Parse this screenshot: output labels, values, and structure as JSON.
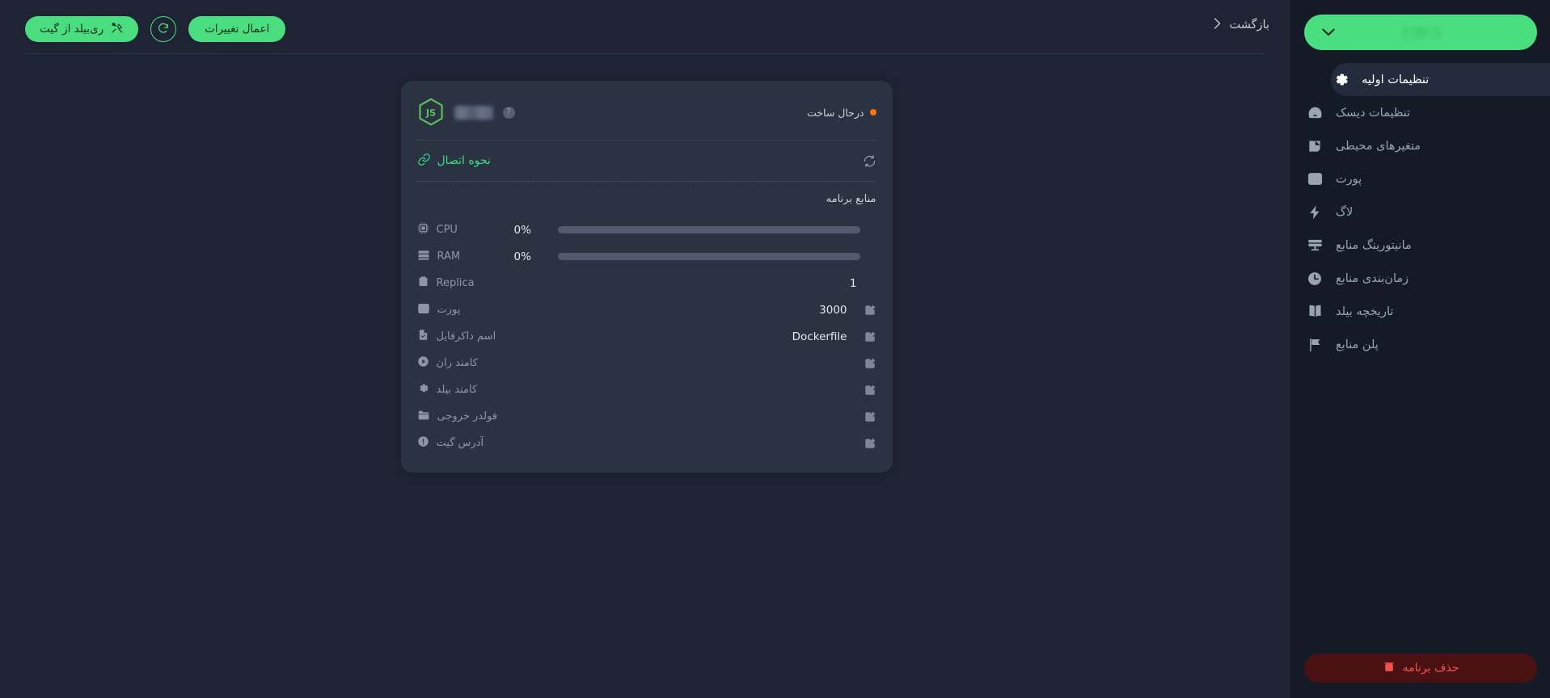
{
  "app": {
    "platform_icon": "nodejs-logo",
    "name_redacted": true,
    "status_label": "درحال ساخت",
    "status_color": "#f97316",
    "help_icon": "?"
  },
  "topbar": {
    "back_label": "بازگشت",
    "back_icon": "chevron-left-icon",
    "apply_changes_label": "اعمال تغییرات",
    "refresh_icon": "refresh-icon",
    "rebuild_from_git_label": "ری‌بیلد از گیت",
    "rebuild_icon": "tools-icon"
  },
  "sidebar": {
    "selector": {
      "icon": "chevron-down-icon",
      "value_redacted": ""
    },
    "items": [
      {
        "label": "تنظیمات اولیه",
        "icon": "gear-icon",
        "active": true
      },
      {
        "label": "تنظیمات دیسک",
        "icon": "hard-drive-icon",
        "active": false
      },
      {
        "label": "متغیرهای محیطی",
        "icon": "memory-chip-icon",
        "active": false
      },
      {
        "label": "پورت",
        "icon": "browser-window-icon",
        "active": false
      },
      {
        "label": "لاگ",
        "icon": "lightning-bolt-icon",
        "active": false
      },
      {
        "label": "مانیتورینگ منابع",
        "icon": "monitor-icon",
        "active": false
      },
      {
        "label": "زمان‌بندی منابع",
        "icon": "clock-icon",
        "active": false
      },
      {
        "label": "تاریخچه بیلد",
        "icon": "book-icon",
        "active": false
      },
      {
        "label": "پلن منابع",
        "icon": "flag-icon",
        "active": false
      }
    ],
    "delete_app": {
      "label": "حذف برنامه",
      "icon": "trash-icon",
      "color": "#ef5350",
      "background": "#4a1113"
    }
  },
  "card": {
    "connection": {
      "label": "نحوه اتصال",
      "icon": "link-icon",
      "color": "#3ddc84",
      "refresh_icon": "refresh-icon"
    },
    "resources_title": "منابع برنامه",
    "meters": [
      {
        "label": "CPU",
        "icon": "cpu-icon",
        "value": "0%",
        "percent": 0
      },
      {
        "label": "RAM",
        "icon": "ram-icon",
        "value": "0%",
        "percent": 0
      }
    ],
    "properties": [
      {
        "label": "Replica",
        "icon": "clipboard-icon",
        "value": "1",
        "editable": false
      },
      {
        "label": "پورت",
        "icon": "browser-window-icon",
        "value": "3000",
        "editable": true
      },
      {
        "label": "اسم داکرفایل",
        "icon": "file-check-icon",
        "value": "Dockerfile",
        "editable": true
      },
      {
        "label": "کامند ران",
        "icon": "play-circle-icon",
        "value": "",
        "editable": true
      },
      {
        "label": "کامند بیلد",
        "icon": "gear-icon",
        "value": "",
        "editable": true
      },
      {
        "label": "فولدر خروجی",
        "icon": "folder-icon",
        "value": "",
        "editable": true
      },
      {
        "label": "آدرس گیت",
        "icon": "info-circle-icon",
        "value": "",
        "editable": true,
        "redacted": true
      }
    ]
  },
  "colors": {
    "page_bg": "#1e2433",
    "sidebar_bg": "#141a26",
    "card_bg": "#2b3342",
    "accent_green": "#4ade80",
    "link_green": "#3ddc84",
    "danger_red": "#ef5350",
    "status_orange": "#f97316"
  }
}
